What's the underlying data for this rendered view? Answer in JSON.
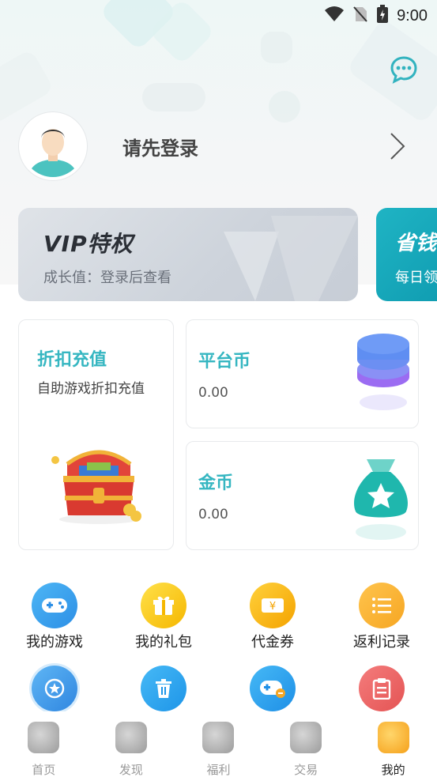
{
  "status": {
    "time": "9:00"
  },
  "profile": {
    "login_prompt": "请先登录"
  },
  "vip": {
    "title": "VIP特权",
    "subtitle": "成长值：登录后查看"
  },
  "save_card": {
    "title": "省钱",
    "subtitle": "每日领"
  },
  "recharge": {
    "title": "折扣充值",
    "subtitle": "自助游戏折扣充值"
  },
  "platform_coin": {
    "title": "平台币",
    "value": "0.00"
  },
  "gold_coin": {
    "title": "金币",
    "value": "0.00"
  },
  "grid": {
    "items": [
      {
        "label": "我的游戏",
        "icon": "gamepad-icon"
      },
      {
        "label": "我的礼包",
        "icon": "gift-icon"
      },
      {
        "label": "代金券",
        "icon": "voucher-icon"
      },
      {
        "label": "返利记录",
        "icon": "list-icon"
      },
      {
        "label": "",
        "icon": "star-icon"
      },
      {
        "label": "",
        "icon": "trash-icon"
      },
      {
        "label": "",
        "icon": "gamepad-download-icon"
      },
      {
        "label": "",
        "icon": "clipboard-icon"
      }
    ]
  },
  "tabs": [
    {
      "label": "首页",
      "active": false
    },
    {
      "label": "发现",
      "active": false
    },
    {
      "label": "福利",
      "active": false
    },
    {
      "label": "交易",
      "active": false
    },
    {
      "label": "我的",
      "active": true
    }
  ],
  "colors": {
    "accent": "#35b6c1",
    "save_card": "#1fb4c4",
    "vip_card": "#d2d8df"
  }
}
